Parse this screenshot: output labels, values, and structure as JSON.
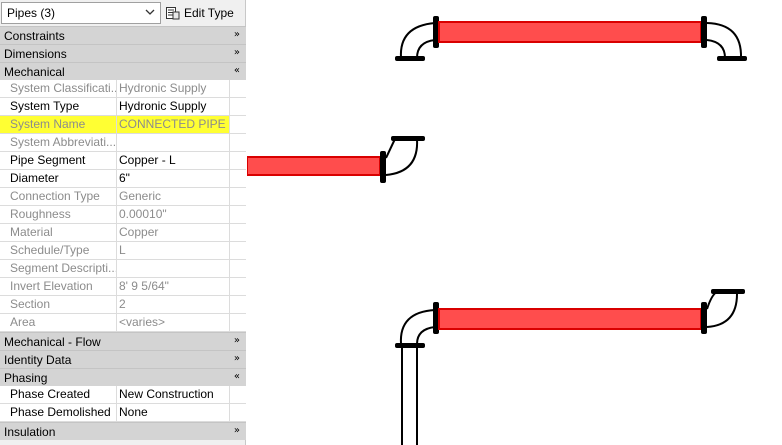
{
  "selector": {
    "value": "Pipes (3)",
    "edit_type_label": "Edit Type"
  },
  "groups": {
    "constraints": "Constraints",
    "dimensions": "Dimensions",
    "mechanical": "Mechanical",
    "mechanical_flow": "Mechanical - Flow",
    "identity": "Identity Data",
    "phasing": "Phasing",
    "insulation": "Insulation"
  },
  "mechanical_rows": [
    {
      "name": "System Classificati...",
      "value": "Hydronic Supply"
    },
    {
      "name": "System Type",
      "value": "Hydronic Supply"
    },
    {
      "name": "System Name",
      "value": "CONNECTED PIPE"
    },
    {
      "name": "System Abbreviati...",
      "value": ""
    },
    {
      "name": "Pipe Segment",
      "value": "Copper - L"
    },
    {
      "name": "Diameter",
      "value": "6\""
    },
    {
      "name": "Connection Type",
      "value": "Generic"
    },
    {
      "name": "Roughness",
      "value": "0.00010\""
    },
    {
      "name": "Material",
      "value": "Copper"
    },
    {
      "name": "Schedule/Type",
      "value": "L"
    },
    {
      "name": "Segment Descripti...",
      "value": ""
    },
    {
      "name": "Invert Elevation",
      "value": "8'  9 5/64\""
    },
    {
      "name": "Section",
      "value": "2"
    },
    {
      "name": "Area",
      "value": "<varies>"
    }
  ],
  "phasing_rows": [
    {
      "name": "Phase Created",
      "value": "New Construction"
    },
    {
      "name": "Phase Demolished",
      "value": "None"
    }
  ],
  "icons": {
    "dropdown": "chevron-down-icon",
    "edit_type": "edit-type-icon",
    "collapse": "double-chevron-up-icon",
    "expand": "double-chevron-down-icon"
  },
  "colors": {
    "pipe_fill": "#ff4d4d",
    "pipe_edge": "#d90000",
    "highlight": "#ffff33"
  }
}
